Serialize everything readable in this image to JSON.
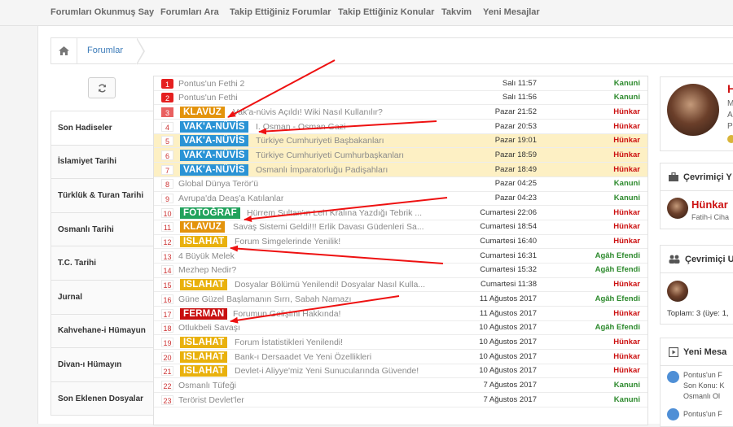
{
  "nav": [
    "Forumları Okunmuş Say",
    "Forumları Ara",
    "Takip Ettiğiniz Forumlar",
    "Takip Ettiğiniz Konular",
    "Takvim",
    "Yeni Mesajlar"
  ],
  "breadcrumb": {
    "home_icon": "home-icon",
    "current": "Forumlar"
  },
  "refresh_icon": "refresh-icon",
  "sidebar": [
    "Son Hadiseler",
    "İslamiyet Tarihi",
    "Türklük & Turan Tarihi",
    "Osmanlı Tarihi",
    "T.C. Tarihi",
    "Jurnal",
    "Kahvehane-i Hümayun",
    "Divan-ı Hümayın",
    "Son Eklenen Dosyalar"
  ],
  "colors": {
    "green_user": "#2d8a2d",
    "red_user": "#cc1111",
    "link_blue": "#3a7ab8",
    "highlight_row": "#fdf0c4"
  },
  "threads": [
    {
      "n": "1",
      "prefix": "",
      "title": "Pontus'un Fethi 2",
      "date": "Salı 11:57",
      "user": "Kanuni",
      "uc": "green",
      "badge": "red",
      "hl": false
    },
    {
      "n": "2",
      "prefix": "",
      "title": "Pontus'un Fethi",
      "date": "Salı 11:56",
      "user": "Kanuni",
      "uc": "green",
      "badge": "red",
      "hl": false
    },
    {
      "n": "3",
      "prefix": "KLAVUZ",
      "title": "Vak'a-nüvis Açıldı! Wiki Nasıl Kullanılır?",
      "date": "Pazar 21:52",
      "user": "Hünkar",
      "uc": "red",
      "badge": "pink",
      "hl": false
    },
    {
      "n": "4",
      "prefix": "VAK'A-NÜVİS",
      "title": "I. Osman - Osman Gazi",
      "date": "Pazar 20:53",
      "user": "Hünkar",
      "uc": "red",
      "badge": "",
      "hl": false
    },
    {
      "n": "5",
      "prefix": "VAK'A-NÜVİS",
      "title": "Türkiye Cumhuriyeti Başbakanları",
      "date": "Pazar 19:01",
      "user": "Hünkar",
      "uc": "red",
      "badge": "",
      "hl": true
    },
    {
      "n": "6",
      "prefix": "VAK'A-NÜVİS",
      "title": "Türkiye Cumhuriyeti Cumhurbaşkanları",
      "date": "Pazar 18:59",
      "user": "Hünkar",
      "uc": "red",
      "badge": "",
      "hl": true
    },
    {
      "n": "7",
      "prefix": "VAK'A-NÜVİS",
      "title": "Osmanlı İmparatorluğu Padişahları",
      "date": "Pazar 18:49",
      "user": "Hünkar",
      "uc": "red",
      "badge": "",
      "hl": true
    },
    {
      "n": "8",
      "prefix": "",
      "title": "Global Dünya Terör'ü",
      "date": "Pazar 04:25",
      "user": "Kanuni",
      "uc": "green",
      "badge": "",
      "hl": false
    },
    {
      "n": "9",
      "prefix": "",
      "title": "Avrupa'da Deaş'a Katılanlar",
      "date": "Pazar 04:23",
      "user": "Kanuni",
      "uc": "green",
      "badge": "",
      "hl": false
    },
    {
      "n": "10",
      "prefix": "FOTOĞRAF",
      "title": "Hürrem Sultan'ın Leh Kralına Yazdığı Tebrik ...",
      "date": "Cumartesi 22:06",
      "user": "Hünkar",
      "uc": "red",
      "badge": "",
      "hl": false
    },
    {
      "n": "11",
      "prefix": "KLAVUZ",
      "title": "Savaş Sistemi Geldi!!! Erlik Davası Güdenleri Sa...",
      "date": "Cumartesi 18:54",
      "user": "Hünkar",
      "uc": "red",
      "badge": "",
      "hl": false
    },
    {
      "n": "12",
      "prefix": "ISLAHAT",
      "title": "Forum Simgelerinde Yenilik!",
      "date": "Cumartesi 16:40",
      "user": "Hünkar",
      "uc": "red",
      "badge": "",
      "hl": false
    },
    {
      "n": "13",
      "prefix": "",
      "title": "4 Büyük Melek",
      "date": "Cumartesi 16:31",
      "user": "Agâh Efendi",
      "uc": "green",
      "badge": "",
      "hl": false
    },
    {
      "n": "14",
      "prefix": "",
      "title": "Mezhep Nedir?",
      "date": "Cumartesi 15:32",
      "user": "Agâh Efendi",
      "uc": "green",
      "badge": "",
      "hl": false
    },
    {
      "n": "15",
      "prefix": "ISLAHAT",
      "title": "Dosyalar Bölümü Yenilendi! Dosyalar Nasıl Kulla...",
      "date": "Cumartesi 11:38",
      "user": "Hünkar",
      "uc": "red",
      "badge": "",
      "hl": false
    },
    {
      "n": "16",
      "prefix": "",
      "title": "Güne Güzel Başlamanın Sırrı, Sabah Namazı",
      "date": "11 Ağustos 2017",
      "user": "Agâh Efendi",
      "uc": "green",
      "badge": "",
      "hl": false
    },
    {
      "n": "17",
      "prefix": "FERMAN",
      "title": "Forumun Gelişimi Hakkında!",
      "date": "11 Ağustos 2017",
      "user": "Hünkar",
      "uc": "red",
      "badge": "",
      "hl": false
    },
    {
      "n": "18",
      "prefix": "",
      "title": "Otlukbeli Savaşı",
      "date": "10 Ağustos 2017",
      "user": "Agâh Efendi",
      "uc": "green",
      "badge": "",
      "hl": false
    },
    {
      "n": "19",
      "prefix": "ISLAHAT",
      "title": "Forum İstatistikleri Yenilendi!",
      "date": "10 Ağustos 2017",
      "user": "Hünkar",
      "uc": "red",
      "badge": "",
      "hl": false
    },
    {
      "n": "20",
      "prefix": "ISLAHAT",
      "title": "Bank-ı Dersaadet Ve Yeni Özellikleri",
      "date": "10 Ağustos 2017",
      "user": "Hünkar",
      "uc": "red",
      "badge": "",
      "hl": false
    },
    {
      "n": "21",
      "prefix": "ISLAHAT",
      "title": "Devlet-i Aliyye'miz Yeni Sunucularında Güvende!",
      "date": "10 Ağustos 2017",
      "user": "Hünkar",
      "uc": "red",
      "badge": "",
      "hl": false
    },
    {
      "n": "22",
      "prefix": "",
      "title": "Osmanlı Tüfeği",
      "date": "7 Ağustos 2017",
      "user": "Kanuni",
      "uc": "green",
      "badge": "",
      "hl": false
    },
    {
      "n": "23",
      "prefix": "",
      "title": "Terörist Devlet'ler",
      "date": "7 Ağustos 2017",
      "user": "Kanuni",
      "uc": "green",
      "badge": "",
      "hl": false
    }
  ],
  "profile": {
    "name": "H",
    "lines": [
      "M",
      "Al",
      "Pu"
    ]
  },
  "online_staff": {
    "title": "Çevrimiçi Y",
    "user": "Hünkar",
    "sub": "Fatih-i Ciha"
  },
  "online_users": {
    "title": "Çevrimiçi U",
    "total": "Toplam: 3 (üye: 1,"
  },
  "new_posts": {
    "title": "Yeni Mesa",
    "items": [
      {
        "line1": "Pontus'un F",
        "line2": "Son Konu: K",
        "line3": "Osmanlı Ol"
      },
      {
        "line1": "Pontus'un F",
        "line2": "",
        "line3": ""
      }
    ]
  }
}
